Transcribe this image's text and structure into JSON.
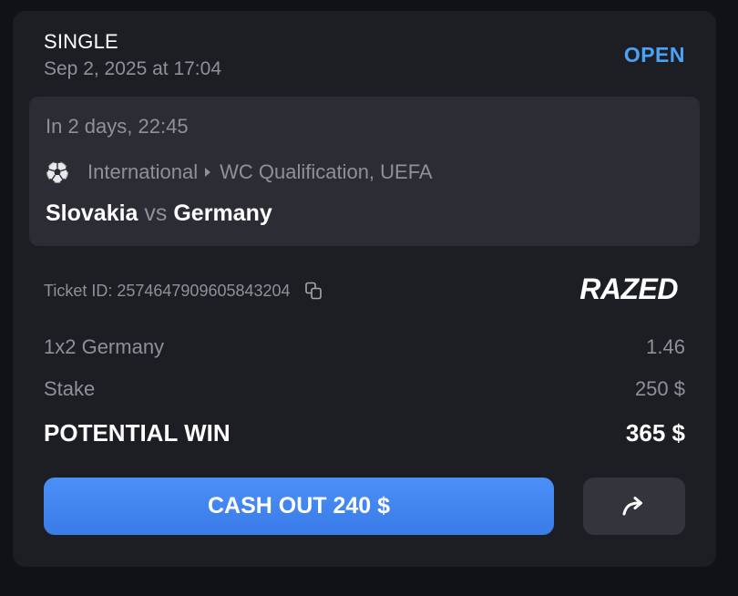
{
  "header": {
    "bet_type": "SINGLE",
    "placed_at": "Sep 2, 2025 at 17:04",
    "status": "OPEN"
  },
  "event": {
    "starts_in": "In 2 days, 22:45",
    "sport_icon": "soccer-ball-icon",
    "category": "International",
    "league": "WC Qualification, UEFA",
    "home_team": "Slovakia",
    "vs_label": "vs",
    "away_team": "Germany"
  },
  "ticket": {
    "id_label": "Ticket ID: 2574647909605843204",
    "copy_icon": "copy-icon",
    "brand": "RAZED"
  },
  "lines": {
    "selection_label": "1x2 Germany",
    "selection_odds": "1.46",
    "stake_label": "Stake",
    "stake_value": "250 $",
    "win_label": "POTENTIAL WIN",
    "win_value": "365 $"
  },
  "actions": {
    "cashout_label": "CASH OUT 240 $",
    "share_icon": "share-arrow-icon"
  },
  "colors": {
    "accent": "#4aa3f5",
    "button": "#3a7ce8",
    "card": "#1d1e23",
    "event_box": "#2b2c34"
  }
}
